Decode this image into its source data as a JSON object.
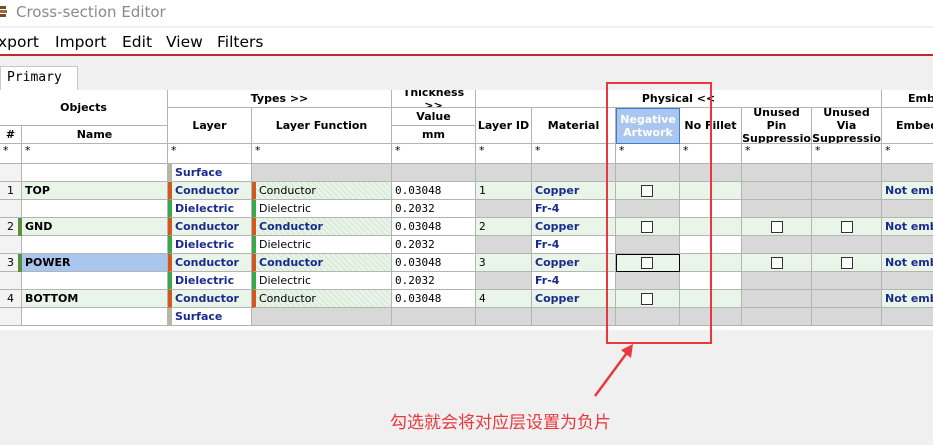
{
  "window": {
    "title": "Cross-section Editor",
    "app_icon": "app-icon"
  },
  "menu": [
    "xport",
    "Import",
    "Edit",
    "View",
    "Filters"
  ],
  "tabs": [
    "Primary"
  ],
  "headers": {
    "objects": "Objects",
    "types": "Types >>",
    "thickness": "Thickness >>",
    "physical": "Physical <<",
    "emb": "Emb",
    "num": "#",
    "name": "Name",
    "layer": "Layer",
    "layer_function": "Layer Function",
    "value": "Value",
    "mm": "mm",
    "layer_id": "Layer ID",
    "material": "Material",
    "negative_artwork": "Negative Artwork",
    "no_fillet": "No Fillet",
    "unused_pin": "Unused Pin Suppressio",
    "unused_via": "Unused Via Suppressio",
    "embed": "Embed",
    "filter": "*"
  },
  "rows": [
    {
      "num": "",
      "name": "",
      "layer": "Surface",
      "func": "",
      "value": "",
      "layer_id": "",
      "material": "",
      "neg": false,
      "pin": false,
      "via": false,
      "embed": ""
    },
    {
      "num": "1",
      "name": "TOP",
      "layer": "Conductor",
      "func": "Conductor",
      "value": "0.03048",
      "layer_id": "1",
      "material": "Copper",
      "neg": true,
      "pin": false,
      "via": false,
      "embed": "Not embe"
    },
    {
      "num": "",
      "name": "",
      "layer": "Dielectric",
      "func": "Dielectric",
      "value": "0.2032",
      "layer_id": "",
      "material": "Fr-4",
      "neg": false,
      "pin": false,
      "via": false,
      "embed": ""
    },
    {
      "num": "2",
      "name": "GND",
      "layer": "Conductor",
      "func": "Conductor",
      "value": "0.03048",
      "layer_id": "2",
      "material": "Copper",
      "neg": true,
      "pin": true,
      "via": true,
      "embed": "Not embe"
    },
    {
      "num": "",
      "name": "",
      "layer": "Dielectric",
      "func": "Dielectric",
      "value": "0.2032",
      "layer_id": "",
      "material": "Fr-4",
      "neg": false,
      "pin": false,
      "via": false,
      "embed": ""
    },
    {
      "num": "3",
      "name": "POWER",
      "layer": "Conductor",
      "func": "Conductor",
      "value": "0.03048",
      "layer_id": "3",
      "material": "Copper",
      "neg": true,
      "pin": true,
      "via": true,
      "embed": "Not embe"
    },
    {
      "num": "",
      "name": "",
      "layer": "Dielectric",
      "func": "Dielectric",
      "value": "0.2032",
      "layer_id": "",
      "material": "Fr-4",
      "neg": false,
      "pin": false,
      "via": false,
      "embed": ""
    },
    {
      "num": "4",
      "name": "BOTTOM",
      "layer": "Conductor",
      "func": "Conductor",
      "value": "0.03048",
      "layer_id": "4",
      "material": "Copper",
      "neg": true,
      "pin": false,
      "via": false,
      "embed": "Not embe"
    },
    {
      "num": "",
      "name": "",
      "layer": "Surface",
      "func": "",
      "value": "",
      "layer_id": "",
      "material": "",
      "neg": false,
      "pin": false,
      "via": false,
      "embed": ""
    }
  ],
  "annotation": {
    "text": "勾选就会将对应层设置为负片",
    "color": "#e8383d"
  },
  "colors": {
    "accent_red": "#c1272d",
    "layer_blue": "#1a2a8c",
    "selection": "#a9c6ef",
    "conductor_bar": "#d05a1e",
    "dielectric_bar": "#3aa84c"
  }
}
